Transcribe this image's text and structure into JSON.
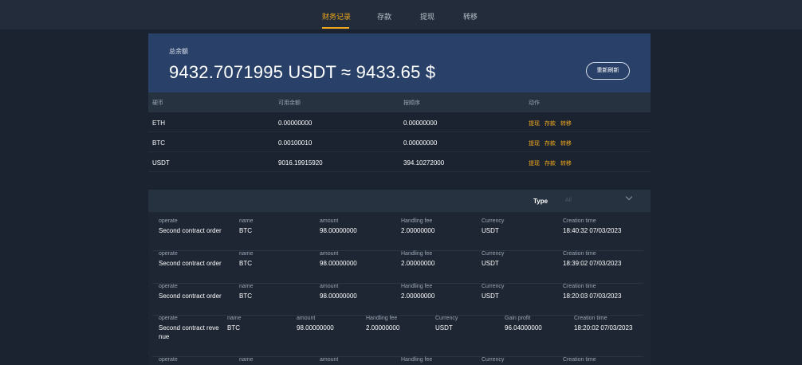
{
  "nav": {
    "tabs": [
      "财务记录",
      "存款",
      "提现",
      "转移"
    ],
    "active_tab": 0,
    "accent_color": "#f0a81c"
  },
  "balance": {
    "label": "总余额",
    "amount": "9432.7071995 USDT ≈ 9433.65 $",
    "refresh_label": "重新刷新"
  },
  "assets": {
    "columns": [
      "硬币",
      "可用余额",
      "按顺序",
      "动作"
    ],
    "rows": [
      {
        "coin": "ETH",
        "available": "0.00000000",
        "in_order": "0.00000000"
      },
      {
        "coin": "BTC",
        "available": "0.00100010",
        "in_order": "0.00000000"
      },
      {
        "coin": "USDT",
        "available": "9016.19915920",
        "in_order": "394.10272000"
      }
    ],
    "actions": [
      "提现",
      "存款",
      "转移"
    ]
  },
  "records": {
    "filter": {
      "label": "Type",
      "value": "All"
    },
    "items": [
      {
        "fields": [
          {
            "label": "operate",
            "value": "Second contract order"
          },
          {
            "label": "name",
            "value": "BTC"
          },
          {
            "label": "amount",
            "value": "98.00000000"
          },
          {
            "label": "Handling fee",
            "value": "2.00000000"
          },
          {
            "label": "Currency",
            "value": "USDT"
          },
          {
            "label": "Creation time",
            "value": "18:40:32 07/03/2023"
          }
        ]
      },
      {
        "fields": [
          {
            "label": "operate",
            "value": "Second contract order"
          },
          {
            "label": "name",
            "value": "BTC"
          },
          {
            "label": "amount",
            "value": "98.00000000"
          },
          {
            "label": "Handling fee",
            "value": "2.00000000"
          },
          {
            "label": "Currency",
            "value": "USDT"
          },
          {
            "label": "Creation time",
            "value": "18:39:02 07/03/2023"
          }
        ]
      },
      {
        "fields": [
          {
            "label": "operate",
            "value": "Second contract order"
          },
          {
            "label": "name",
            "value": "BTC"
          },
          {
            "label": "amount",
            "value": "98.00000000"
          },
          {
            "label": "Handling fee",
            "value": "2.00000000"
          },
          {
            "label": "Currency",
            "value": "USDT"
          },
          {
            "label": "Creation time",
            "value": "18:20:03 07/03/2023"
          }
        ]
      },
      {
        "fields": [
          {
            "label": "operate",
            "value": "Second contract reve nue"
          },
          {
            "label": "name",
            "value": "BTC"
          },
          {
            "label": "amount",
            "value": "98.00000000"
          },
          {
            "label": "Handling fee",
            "value": "2.00000000"
          },
          {
            "label": "Currency",
            "value": "USDT"
          },
          {
            "label": "Gain profit",
            "value": "96.04000000"
          },
          {
            "label": "Creation time",
            "value": "18:20:02 07/03/2023"
          }
        ]
      },
      {
        "fields": [
          {
            "label": "operate",
            "value": ""
          },
          {
            "label": "name",
            "value": ""
          },
          {
            "label": "amount",
            "value": ""
          },
          {
            "label": "Handling fee",
            "value": ""
          },
          {
            "label": "Currency",
            "value": ""
          },
          {
            "label": "Creation time",
            "value": ""
          }
        ]
      }
    ]
  }
}
